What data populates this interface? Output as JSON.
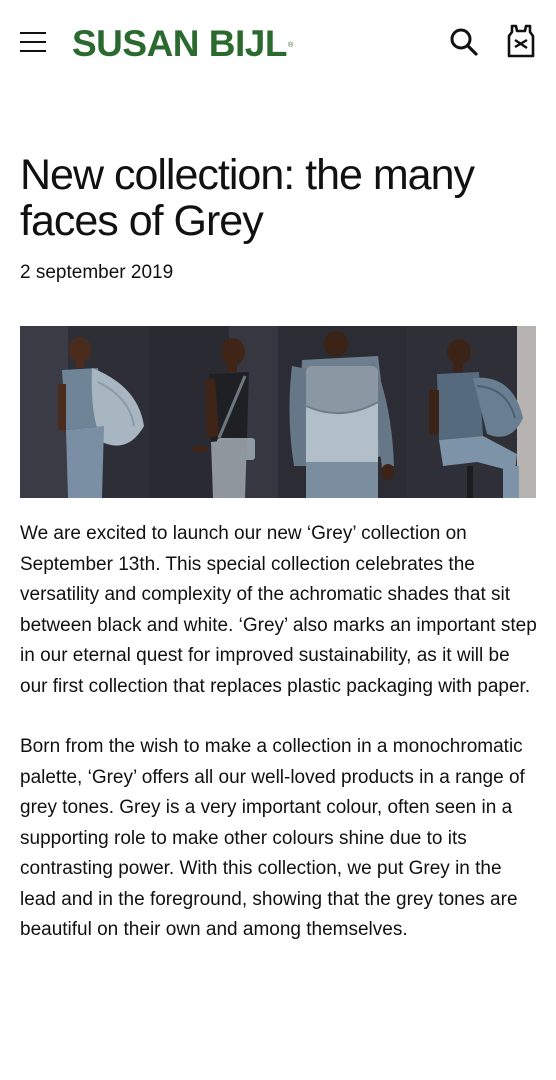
{
  "header": {
    "logo_text": "SUSAN BIJL",
    "logo_mark": "®",
    "brand_color": "#2b6a2f",
    "icons": [
      "hamburger-menu-icon",
      "search-icon",
      "shopping-bag-icon"
    ]
  },
  "article": {
    "title": "New collection: the many faces of Grey",
    "date": "2 september 2019",
    "paragraphs": [
      "We are excited to launch our new ‘Grey’ collection on September 13th. This special collection celebrates the versatility and complexity of the achromatic shades that sit between black and white. ‘Grey’ also marks an important step in our eternal quest for improved sustainability, as it will be our first collection that replaces plastic packaging with paper.",
      "Born from the wish to make a collection in a monochromatic palette, ‘Grey’ offers all our well-loved products in a range of grey tones. Grey is a very important colour, often seen in a supporting role to make other colours shine due to its contrasting power. With this collection, we put Grey in the lead and in the foreground, showing that the grey tones are beautiful on their own and among themselves."
    ]
  }
}
